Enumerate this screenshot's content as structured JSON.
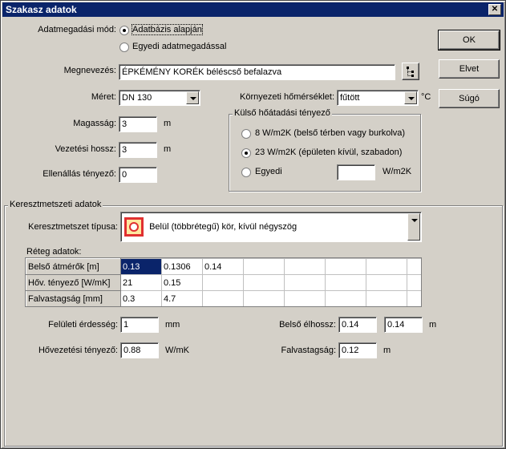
{
  "window": {
    "title": "Szakasz adatok",
    "close_label": "✕"
  },
  "buttons": {
    "ok": "OK",
    "cancel": "Elvet",
    "help": "Súgó"
  },
  "data_entry": {
    "label": "Adatmegadási mód:",
    "option_database": "Adatbázis alapján",
    "option_custom": "Egyedi adatmegadással",
    "selected": "database"
  },
  "name": {
    "label": "Megnevezés:",
    "value": "ÉPKÉMÉNY KORÉK béléscső befalazva"
  },
  "size": {
    "label": "Méret:",
    "value": "DN 130"
  },
  "height": {
    "label": "Magasság:",
    "value": "3",
    "unit": "m"
  },
  "pipe_length": {
    "label": "Vezetési hossz:",
    "value": "3",
    "unit": "m"
  },
  "resistance": {
    "label": "Ellenállás tényező:",
    "value": "0"
  },
  "ambient_temp": {
    "label": "Környezeti hőmérséklet:",
    "value": "fűtött",
    "unit": "°C"
  },
  "external_heat_transfer": {
    "title": "Külső hőátadási tényező",
    "option1": "8 W/m2K (belső térben vagy burkolva)",
    "option2": "23 W/m2K (épületen kívül, szabadon)",
    "option3": "Egyedi",
    "custom_value": "",
    "custom_unit": "W/m2K",
    "selected": "option2"
  },
  "cross_section": {
    "title": "Keresztmetszeti adatok",
    "type_label": "Keresztmetszet típusa:",
    "type_value": "Belül (többrétegű) kör, kívül négyszög",
    "layer_label": "Réteg adatok:",
    "rows": [
      {
        "header": "Belső átmérők [m]",
        "values": [
          "0.13",
          "0.1306",
          "0.14",
          "",
          "",
          "",
          "",
          ""
        ]
      },
      {
        "header": "Hőv. tényező [W/mK]",
        "values": [
          "21",
          "0.15",
          "",
          "",
          "",
          "",
          "",
          ""
        ]
      },
      {
        "header": "Falvastagság [mm]",
        "values": [
          "0.3",
          "4.7",
          "",
          "",
          "",
          "",
          "",
          ""
        ]
      }
    ]
  },
  "roughness": {
    "label": "Felületi érdesség:",
    "value": "1",
    "unit": "mm"
  },
  "thermal_conductivity": {
    "label": "Hővezetési tényező:",
    "value": "0.88",
    "unit": "W/mK"
  },
  "inner_edge": {
    "label": "Belső élhossz:",
    "value1": "0.14",
    "value2": "0.14",
    "unit": "m"
  },
  "wall_thickness": {
    "label": "Falvastagság:",
    "value": "0.12",
    "unit": "m"
  }
}
